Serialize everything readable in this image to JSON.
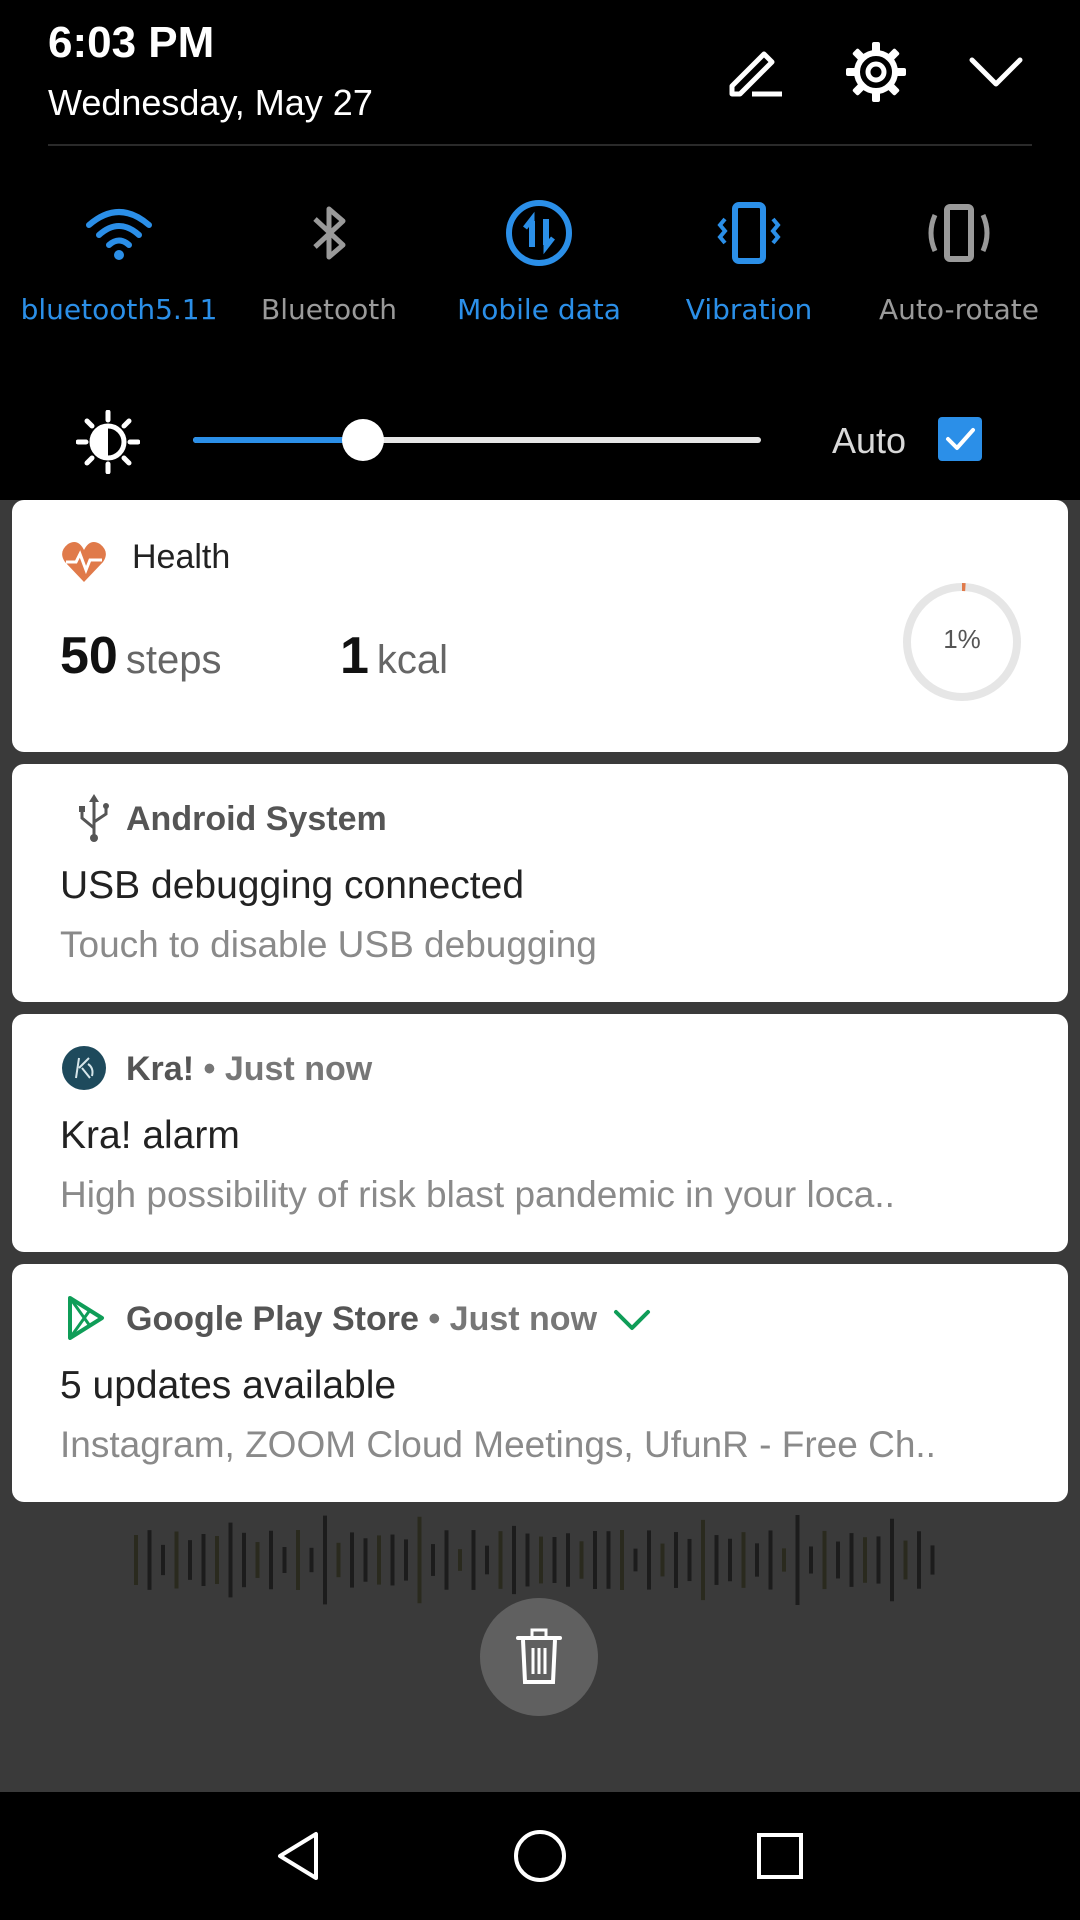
{
  "status": {
    "time": "6:03 PM",
    "date": "Wednesday, May 27"
  },
  "header_icons": [
    "edit-icon",
    "settings-icon",
    "collapse-icon"
  ],
  "tiles": [
    {
      "label": "bluetooth5.11",
      "icon": "wifi-icon",
      "active": true
    },
    {
      "label": "Bluetooth",
      "icon": "bluetooth-icon",
      "active": false
    },
    {
      "label": "Mobile data",
      "icon": "mobile-data-icon",
      "active": true
    },
    {
      "label": "Vibration",
      "icon": "vibration-icon",
      "active": true
    },
    {
      "label": "Auto-rotate",
      "icon": "auto-rotate-icon",
      "active": false
    }
  ],
  "brightness": {
    "level": 0.3,
    "auto_label": "Auto",
    "auto_checked": true
  },
  "health": {
    "app": "Health",
    "steps_value": "50",
    "steps_unit": "steps",
    "kcal_value": "1",
    "kcal_unit": "kcal",
    "progress_label": "1%",
    "progress": 0.01
  },
  "notifications": [
    {
      "app": "Android System",
      "icon": "usb-icon",
      "title": "USB debugging connected",
      "body": "Touch to disable USB debugging"
    },
    {
      "app": "Kra!",
      "separator": "•",
      "time": "Just now",
      "icon": "kra-app-icon",
      "title": "Kra! alarm",
      "body": "High possibility of risk blast pandemic in your loca.."
    },
    {
      "app": "Google Play Store",
      "separator": "•",
      "time": "Just now",
      "icon": "play-store-icon",
      "title": "5 updates available",
      "body": "Instagram, ZOOM Cloud Meetings, UfunR - Free Ch.."
    }
  ],
  "colors": {
    "accent": "#2b8fe8",
    "inactive": "#9a9a9a",
    "health": "#e07a4a",
    "play_green": "#0f9d58",
    "shade_bg": "#3a3a3a"
  }
}
